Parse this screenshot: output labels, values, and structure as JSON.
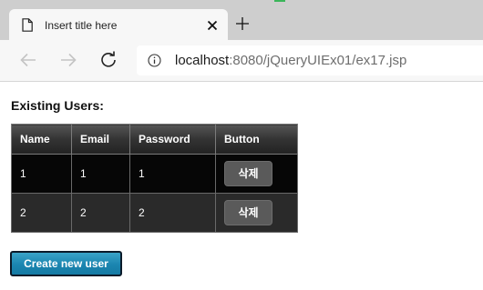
{
  "browser": {
    "tab": {
      "title": "Insert title here"
    },
    "address_bar": {
      "host": "localhost",
      "path": ":8080/jQueryUIEx01/ex17.jsp"
    },
    "icons": {
      "tab": "document-icon",
      "close": "close-icon",
      "new_tab": "plus-icon",
      "back": "arrow-left-icon",
      "forward": "arrow-right-icon",
      "reload": "reload-icon",
      "site_info": "info-icon"
    }
  },
  "page": {
    "heading": "Existing Users:",
    "table": {
      "columns": [
        "Name",
        "Email",
        "Password",
        "Button"
      ],
      "rows": [
        {
          "name": "1",
          "email": "1",
          "password": "1",
          "button": "삭제"
        },
        {
          "name": "2",
          "email": "2",
          "password": "2",
          "button": "삭제"
        }
      ]
    },
    "create_button": "Create new user"
  },
  "colors": {
    "header_gradient_top": "#555555",
    "row_dark": "#060606",
    "row_alt": "#2a2a2a",
    "create_button": "#1b85b0"
  }
}
